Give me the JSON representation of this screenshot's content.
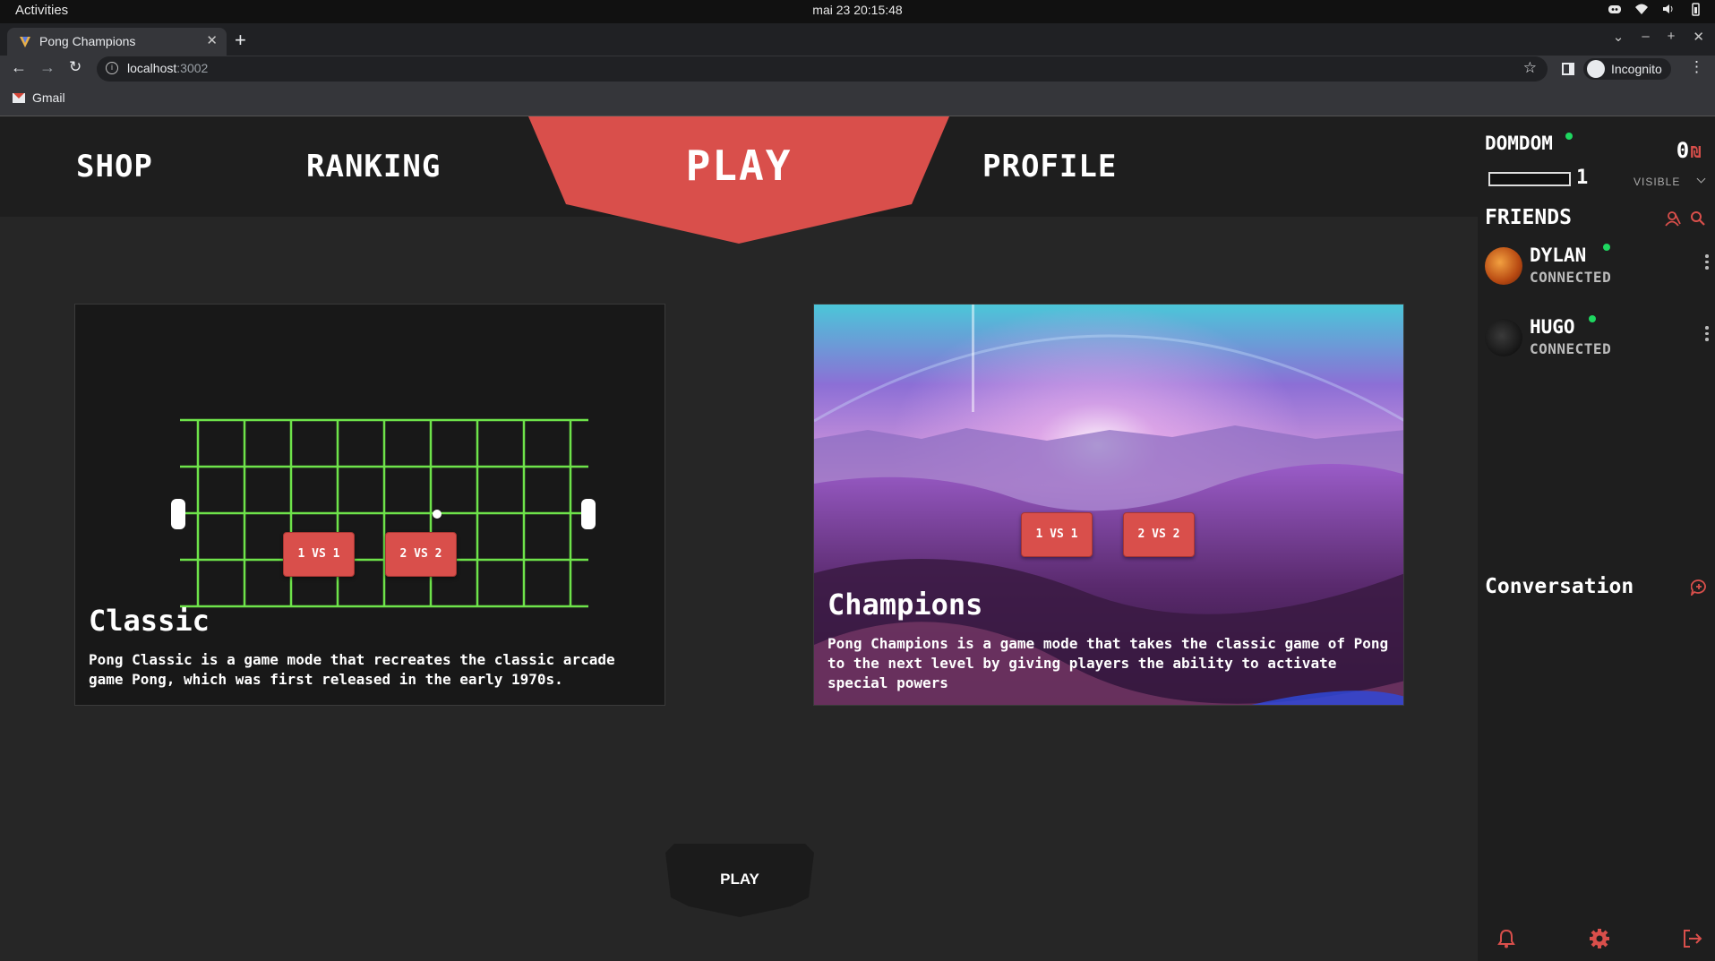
{
  "os": {
    "activities": "Activities",
    "clock": "mai 23  20:15:48"
  },
  "browser": {
    "tab_title": "Pong Champions",
    "url_host": "localhost",
    "url_port": ":3002",
    "profile_label": "Incognito",
    "bookmark": "Gmail"
  },
  "nav": {
    "shop": "SHOP",
    "ranking": "RANKING",
    "play": "PLAY",
    "profile": "PROFILE"
  },
  "modes": {
    "classic": {
      "title": "Classic",
      "description": "Pong Classic is a game mode that recreates the classic arcade game Pong, which was first released in the early 1970s.",
      "btn_1v1": "1 VS 1",
      "btn_2v2": "2 VS 2"
    },
    "champions": {
      "title": "Champions",
      "description": "Pong Champions is a game mode that takes the classic game of Pong to the next level by giving players the ability to activate special powers",
      "btn_1v1": "1 VS 1",
      "btn_2v2": "2 VS 2"
    }
  },
  "play_button": "PLAY",
  "panel": {
    "username": "DOMDOM",
    "coins": "0",
    "currency_symbol": "₪",
    "level": "1",
    "visibility": "VISIBLE",
    "friends_title": "FRIENDS",
    "friends": [
      {
        "name": "DYLAN",
        "status": "CONNECTED"
      },
      {
        "name": "HUGO",
        "status": "CONNECTED"
      }
    ],
    "conversation_title": "Conversation"
  },
  "colors": {
    "accent": "#d94f4b",
    "online": "#1ed760",
    "grid": "#6ee34a",
    "background": "#262626"
  },
  "icons": [
    "add-friend-icon",
    "search-icon",
    "add-conversation-icon",
    "bell-icon",
    "gear-icon",
    "logout-icon"
  ]
}
